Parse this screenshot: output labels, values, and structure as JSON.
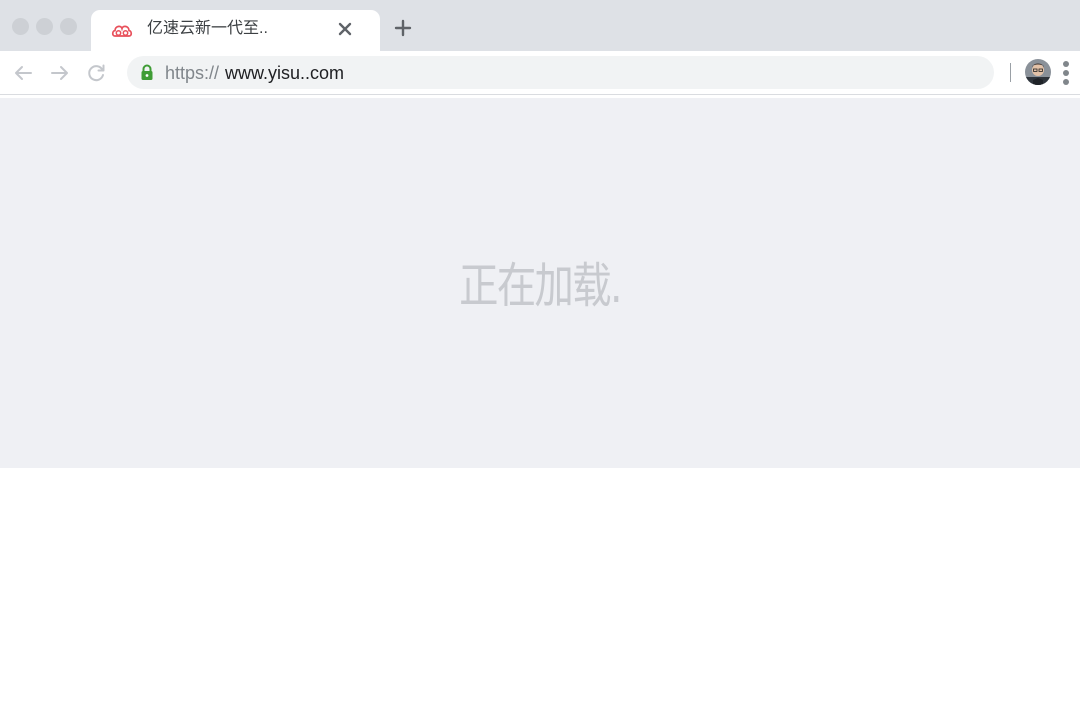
{
  "browser": {
    "tab": {
      "favicon": "yisu-cloud-logo-icon",
      "title": "亿速云新一代至..",
      "close_icon": "close-icon"
    },
    "new_tab_icon": "plus-icon",
    "toolbar": {
      "back_icon": "arrow-left-icon",
      "forward_icon": "arrow-right-icon",
      "reload_icon": "reload-icon",
      "lock_icon": "lock-icon",
      "url_scheme": "https://",
      "url_host": "www.yisu..com",
      "avatar": "user-avatar",
      "menu_icon": "more-vertical-icon"
    }
  },
  "page": {
    "loading_text": "正在加载."
  },
  "colors": {
    "tabstrip": "#dee1e6",
    "content_background": "#eff0f4",
    "favicon_accent": "#e8505b",
    "lock": "#3f9c35"
  }
}
